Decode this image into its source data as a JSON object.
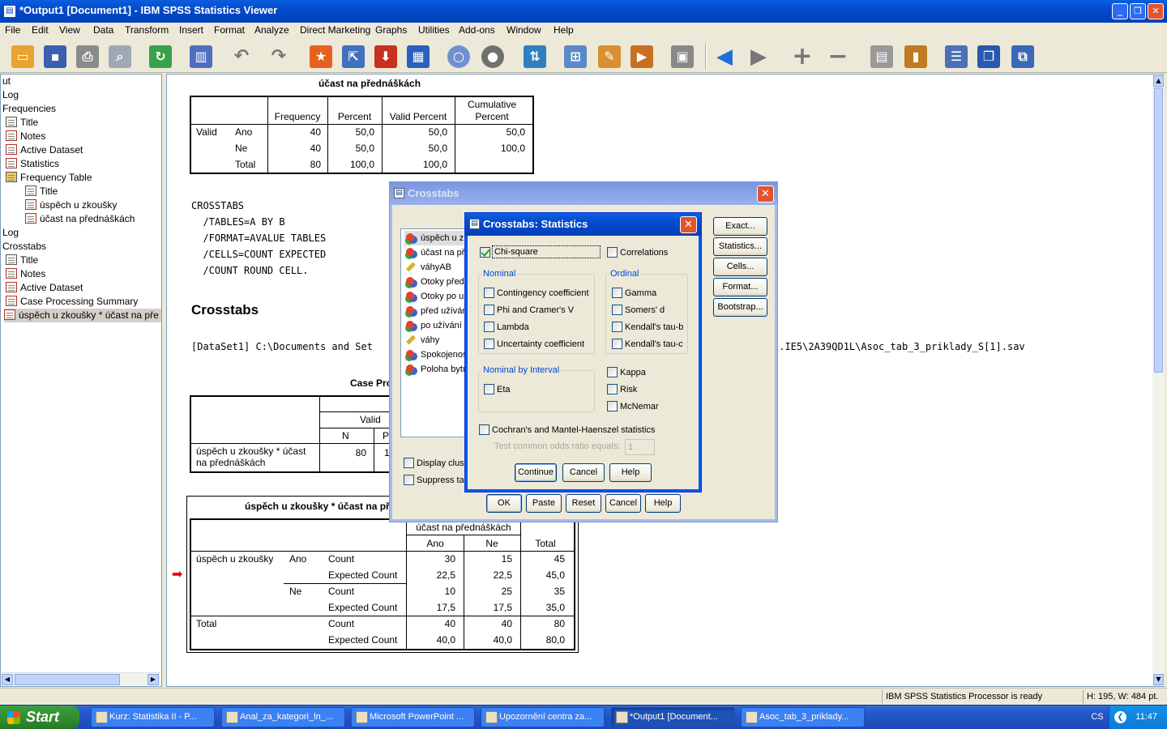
{
  "window": {
    "title": "*Output1 [Document1] - IBM SPSS Statistics Viewer"
  },
  "menu": [
    "File",
    "Edit",
    "View",
    "Data",
    "Transform",
    "Insert",
    "Format",
    "Analyze",
    "Direct Marketing",
    "Graphs",
    "Utilities",
    "Add-ons",
    "Window",
    "Help"
  ],
  "outline": {
    "items": [
      "ut",
      "Log",
      "Frequencies",
      "Title",
      "Notes",
      "Active Dataset",
      "Statistics",
      "Frequency Table",
      "Title",
      "úspěch u zkoušky",
      "účast na přednáškách",
      "Log",
      "Crosstabs",
      "Title",
      "Notes",
      "Active Dataset",
      "Case Processing Summary",
      "úspěch u zkoušky * účast na pře"
    ]
  },
  "freq_table": {
    "title": "účast na přednáškách",
    "headers": [
      "Frequency",
      "Percent",
      "Valid Percent",
      "Cumulative Percent"
    ],
    "valid_label": "Valid",
    "rows": [
      {
        "label": "Ano",
        "frequency": "40",
        "percent": "50,0",
        "valid": "50,0",
        "cum": "50,0"
      },
      {
        "label": "Ne",
        "frequency": "40",
        "percent": "50,0",
        "valid": "50,0",
        "cum": "100,0"
      },
      {
        "label": "Total",
        "frequency": "80",
        "percent": "100,0",
        "valid": "100,0",
        "cum": ""
      }
    ]
  },
  "syntax": [
    "CROSSTABS",
    "  /TABLES=A BY B",
    "  /FORMAT=AVALUE TABLES",
    "  /CELLS=COUNT EXPECTED",
    "  /COUNT ROUND CELL."
  ],
  "crosstabs_heading": "Crosstabs",
  "dataset_path_left": "[DataSet1] C:\\Documents and Set",
  "dataset_path_right": "..IE5\\2A39QD1L\\Asoc_tab_3_priklady_S[1].sav",
  "case_summary": {
    "title": "Case Pro",
    "valid_label": "Valid",
    "n_label": "N",
    "p_label": "P",
    "row_label": "úspěch u zkoušky * účast na přednáškách",
    "n_value": "80",
    "p_value": "1"
  },
  "crosstab": {
    "title": "úspěch u zkoušky * účast na př",
    "col_var": "účast na přednáškách",
    "cols": [
      "Ano",
      "Ne",
      "Total"
    ],
    "row_var": "úspěch u zkoušky",
    "total_label": "Total",
    "rows": [
      {
        "group": "Ano",
        "stat": "Count",
        "vals": [
          "30",
          "15",
          "45"
        ]
      },
      {
        "group": "",
        "stat": "Expected Count",
        "vals": [
          "22,5",
          "22,5",
          "45,0"
        ]
      },
      {
        "group": "Ne",
        "stat": "Count",
        "vals": [
          "10",
          "25",
          "35"
        ]
      },
      {
        "group": "",
        "stat": "Expected Count",
        "vals": [
          "17,5",
          "17,5",
          "35,0"
        ]
      },
      {
        "group": "Total",
        "stat": "Count",
        "vals": [
          "40",
          "40",
          "80"
        ]
      },
      {
        "group": "",
        "stat": "Expected Count",
        "vals": [
          "40,0",
          "40,0",
          "80,0"
        ]
      }
    ]
  },
  "crosstabs_dialog": {
    "title": "Crosstabs",
    "variables": [
      "úspěch u z",
      "účast na př",
      "váhyAB",
      "Otoky před",
      "Otoky po uz",
      "před užívár",
      "po užívání l",
      "váhy",
      "Spokojenos",
      "Poloha bytu"
    ],
    "buttons_right": [
      "Exact...",
      "Statistics...",
      "Cells...",
      "Format...",
      "Bootstrap..."
    ],
    "check_display": "Display clust",
    "check_suppress": "Suppress ta",
    "buttons_bottom": [
      "OK",
      "Paste",
      "Reset",
      "Cancel",
      "Help"
    ]
  },
  "stats_dialog": {
    "title": "Crosstabs: Statistics",
    "chi_square": "Chi-square",
    "correlations": "Correlations",
    "nominal_title": "Nominal",
    "nominal": [
      "Contingency coefficient",
      "Phi and Cramer's V",
      "Lambda",
      "Uncertainty coefficient"
    ],
    "ordinal_title": "Ordinal",
    "ordinal": [
      "Gamma",
      "Somers' d",
      "Kendall's tau-b",
      "Kendall's tau-c"
    ],
    "nbi_title": "Nominal by Interval",
    "eta": "Eta",
    "other": [
      "Kappa",
      "Risk",
      "McNemar"
    ],
    "cochran": "Cochran's and Mantel-Haenszel statistics",
    "odds_label": "Test common odds ratio equals:",
    "odds_value": "1",
    "buttons": [
      "Continue",
      "Cancel",
      "Help"
    ]
  },
  "status": {
    "processor": "IBM SPSS Statistics Processor is ready",
    "size": "H: 195, W: 484 pt."
  },
  "taskbar": {
    "start": "Start",
    "tasks": [
      "Kurz: Statistika II - P...",
      "Anal_za_kategori_ln_...",
      "Microsoft PowerPoint ...",
      "Upozornění centra za...",
      "*Output1 [Document...",
      "Asoc_tab_3_priklady..."
    ],
    "lang": "CS",
    "time": "11:47"
  },
  "colors": {
    "xp_blue": "#0348c8",
    "dialog_face": "#ece9d8",
    "close_red": "#e0552f",
    "start_green": "#2f8b2f"
  }
}
